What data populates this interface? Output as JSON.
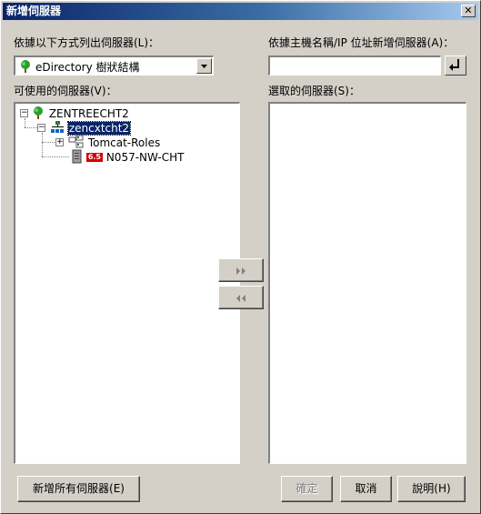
{
  "window": {
    "title": "新增伺服器"
  },
  "left": {
    "list_by_label": "依據以下方式列出伺服器(L)：",
    "combo_value": "eDirectory 樹狀結構",
    "available_label": "可使用的伺服器(V)：",
    "tree": {
      "root": "ZENTREECHT2",
      "org": "zencxtcht2",
      "group": "Tomcat-Roles",
      "server": "N057-NW-CHT",
      "server_badge": "6.5"
    }
  },
  "right": {
    "add_by_host_label": "依據主機名稱/IP 位址新增伺服器(A)：",
    "host_input_value": "",
    "selected_label": "選取的伺服器(S)："
  },
  "buttons": {
    "add_all": "新增所有伺服器(E)",
    "ok": "確定",
    "cancel": "取消",
    "help": "說明(H)"
  },
  "colors": {
    "title_start": "#0a246a",
    "title_end": "#a6caf0",
    "selection": "#0a246a",
    "face": "#d4d0c8"
  }
}
